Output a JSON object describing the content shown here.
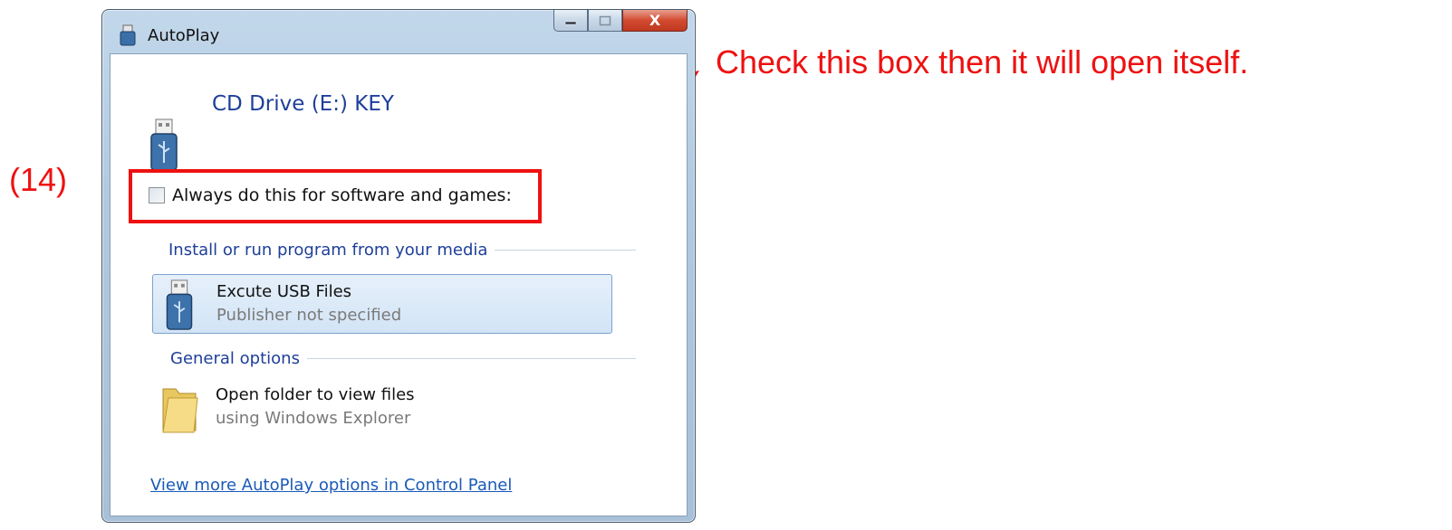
{
  "annotations": {
    "step_label": "(14)",
    "callout": "Check this box then it will open itself.",
    "accent_color": "#ee1111"
  },
  "window": {
    "title": "AutoPlay",
    "title_icon": "usb-drive-icon",
    "close_glyph": "X",
    "drive_title": "CD Drive (E:) KEY",
    "checkbox_label": "Always do this for software and games:",
    "checkbox_checked": false,
    "sections": [
      {
        "heading": "Install or run program from your media",
        "options": [
          {
            "title": "Excute USB Files",
            "subtitle": "Publisher not specified",
            "icon": "usb-drive-icon",
            "selected": true
          }
        ]
      },
      {
        "heading": "General options",
        "options": [
          {
            "title": "Open folder to view files",
            "subtitle": "using Windows Explorer",
            "icon": "folder-icon",
            "selected": false
          }
        ]
      }
    ],
    "control_panel_link": "View more AutoPlay options in Control Panel"
  }
}
